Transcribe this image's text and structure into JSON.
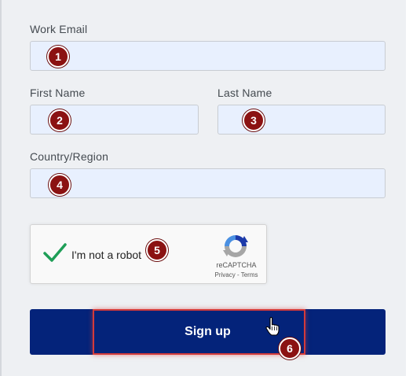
{
  "form": {
    "work_email_label": "Work Email",
    "first_name_label": "First Name",
    "last_name_label": "Last Name",
    "country_label": "Country/Region",
    "work_email_value": "",
    "first_name_value": "",
    "last_name_value": "",
    "country_value": ""
  },
  "captcha": {
    "text": "I'm not a robot",
    "brand": "reCAPTCHA",
    "links": "Privacy - Terms",
    "checked": true
  },
  "signup": {
    "label": "Sign up"
  },
  "markers": [
    "1",
    "2",
    "3",
    "4",
    "5",
    "6"
  ],
  "colors": {
    "field_bg": "#e8f0fe",
    "button_bg": "#04237a",
    "marker_bg": "#8b1212",
    "check": "#1e9e57",
    "highlight": "#d33a3a"
  },
  "icons": {
    "check": "check-icon",
    "recaptcha": "recaptcha-logo-icon",
    "cursor": "hand-cursor-icon"
  }
}
